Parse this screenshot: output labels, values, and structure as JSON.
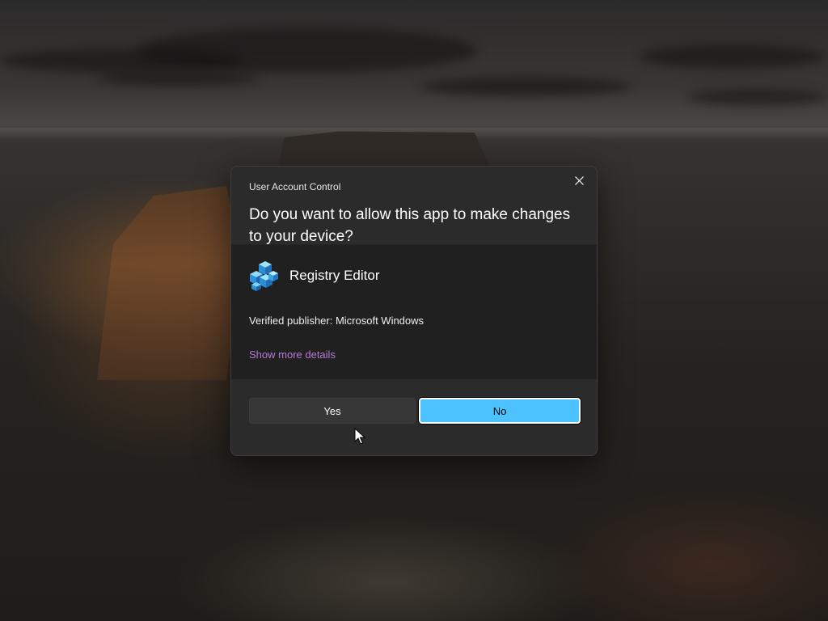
{
  "dialog": {
    "title": "User Account Control",
    "question": "Do you want to allow this app to make changes to your device?",
    "app_name": "Registry Editor",
    "app_icon": "registry-editor-icon",
    "publisher": "Verified publisher: Microsoft Windows",
    "details_link": "Show more details",
    "yes_label": "Yes",
    "no_label": "No",
    "close_icon": "close-icon"
  },
  "colors": {
    "accent": "#4cc2ff",
    "link": "#b67ad6",
    "dialog_bg": "#2b2b2b",
    "body_bg": "#202020"
  }
}
